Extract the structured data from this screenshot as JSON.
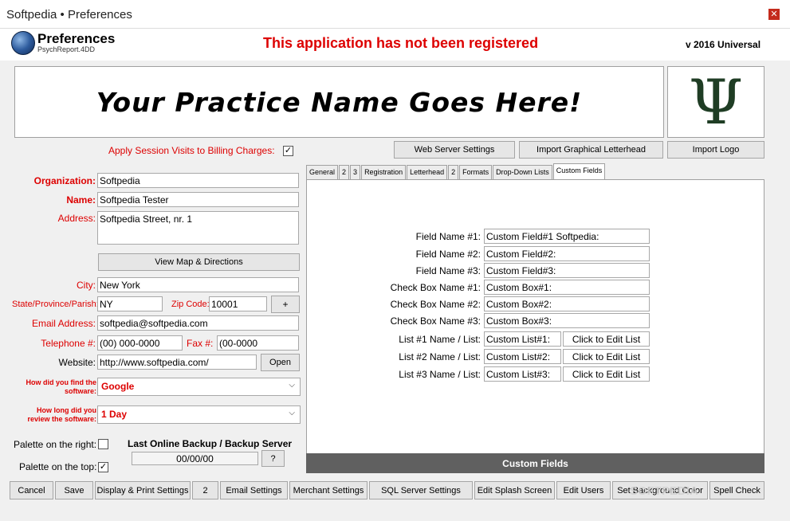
{
  "window": {
    "title": "Softpedia  • Preferences",
    "close_glyph": "✕"
  },
  "header": {
    "title": "Preferences",
    "subtitle": "PsychReport.4DD",
    "warning": "This application has not been registered",
    "version": "v 2016 Universal"
  },
  "banner": {
    "text": "Your Practice Name Goes Here!",
    "logo_glyph": "Ψ"
  },
  "top_buttons": {
    "web_server": "Web Server Settings",
    "import_letterhead": "Import Graphical Letterhead",
    "import_logo": "Import Logo"
  },
  "billing": {
    "label": "Apply Session Visits to Billing Charges:",
    "checked": "✓"
  },
  "form": {
    "organization_label": "Organization:",
    "organization": "Softpedia",
    "name_label": "Name:",
    "name": "Softpedia Tester",
    "address_label": "Address:",
    "address": "Softpedia Street, nr. 1",
    "view_map": "View Map & Directions",
    "city_label": "City:",
    "city": "New York",
    "state_label": "State/Province/Parish:",
    "state": "NY",
    "zip_label": "Zip Code:",
    "zip": "10001",
    "plus": "+",
    "email_label": "Email Address:",
    "email": "softpedia@softpedia.com",
    "telephone_label": "Telephone #:",
    "telephone": "(00) 000-0000",
    "fax_label": "Fax #:",
    "fax": "(00-0000",
    "website_label": "Website:",
    "website": "http://www.softpedia.com/",
    "open": "Open",
    "found_label_1": "How did you find the",
    "found_label_2": "software:",
    "found_value": "Google",
    "review_label_1": "How long did you",
    "review_label_2": "review the software:",
    "review_value": "1 Day",
    "palette_right_label": "Palette on the right:",
    "palette_top_label": "Palette on the top:",
    "palette_top_checked": "✓",
    "backup_title": "Last Online Backup / Backup Server",
    "backup_value": "00/00/00",
    "backup_help": "?"
  },
  "tabs": [
    "General",
    "2",
    "3",
    "Registration",
    "Letterhead",
    "2",
    "Formats",
    "Drop-Down Lists",
    "Custom Fields"
  ],
  "custom": {
    "rows": [
      {
        "label": "Field Name #1:",
        "value": "Custom Field#1 Softpedia:"
      },
      {
        "label": "Field Name #2:",
        "value": "Custom Field#2:"
      },
      {
        "label": "Field Name #3:",
        "value": "Custom Field#3:"
      },
      {
        "label": "Check Box Name #1:",
        "value": "Custom Box#1:"
      },
      {
        "label": "Check Box Name #2:",
        "value": "Custom Box#2:"
      },
      {
        "label": "Check Box Name #3:",
        "value": "Custom Box#3:"
      }
    ],
    "lists": [
      {
        "label": "List #1 Name / List:",
        "value": "Custom List#1:",
        "button": "Click to Edit List"
      },
      {
        "label": "List #2 Name / List:",
        "value": "Custom List#2:",
        "button": "Click to Edit List"
      },
      {
        "label": "List #3 Name / List:",
        "value": "Custom List#3:",
        "button": "Click to Edit List"
      }
    ],
    "footer": "Custom Fields"
  },
  "bottom_buttons": [
    "Cancel",
    "Save",
    "Display & Print Settings",
    "2",
    "Email Settings",
    "Merchant Settings",
    "SQL Server Settings",
    "Edit Splash Screen",
    "Edit Users",
    "Set Background Color",
    "Spell Check"
  ],
  "watermark": "SOFTPEDIA"
}
